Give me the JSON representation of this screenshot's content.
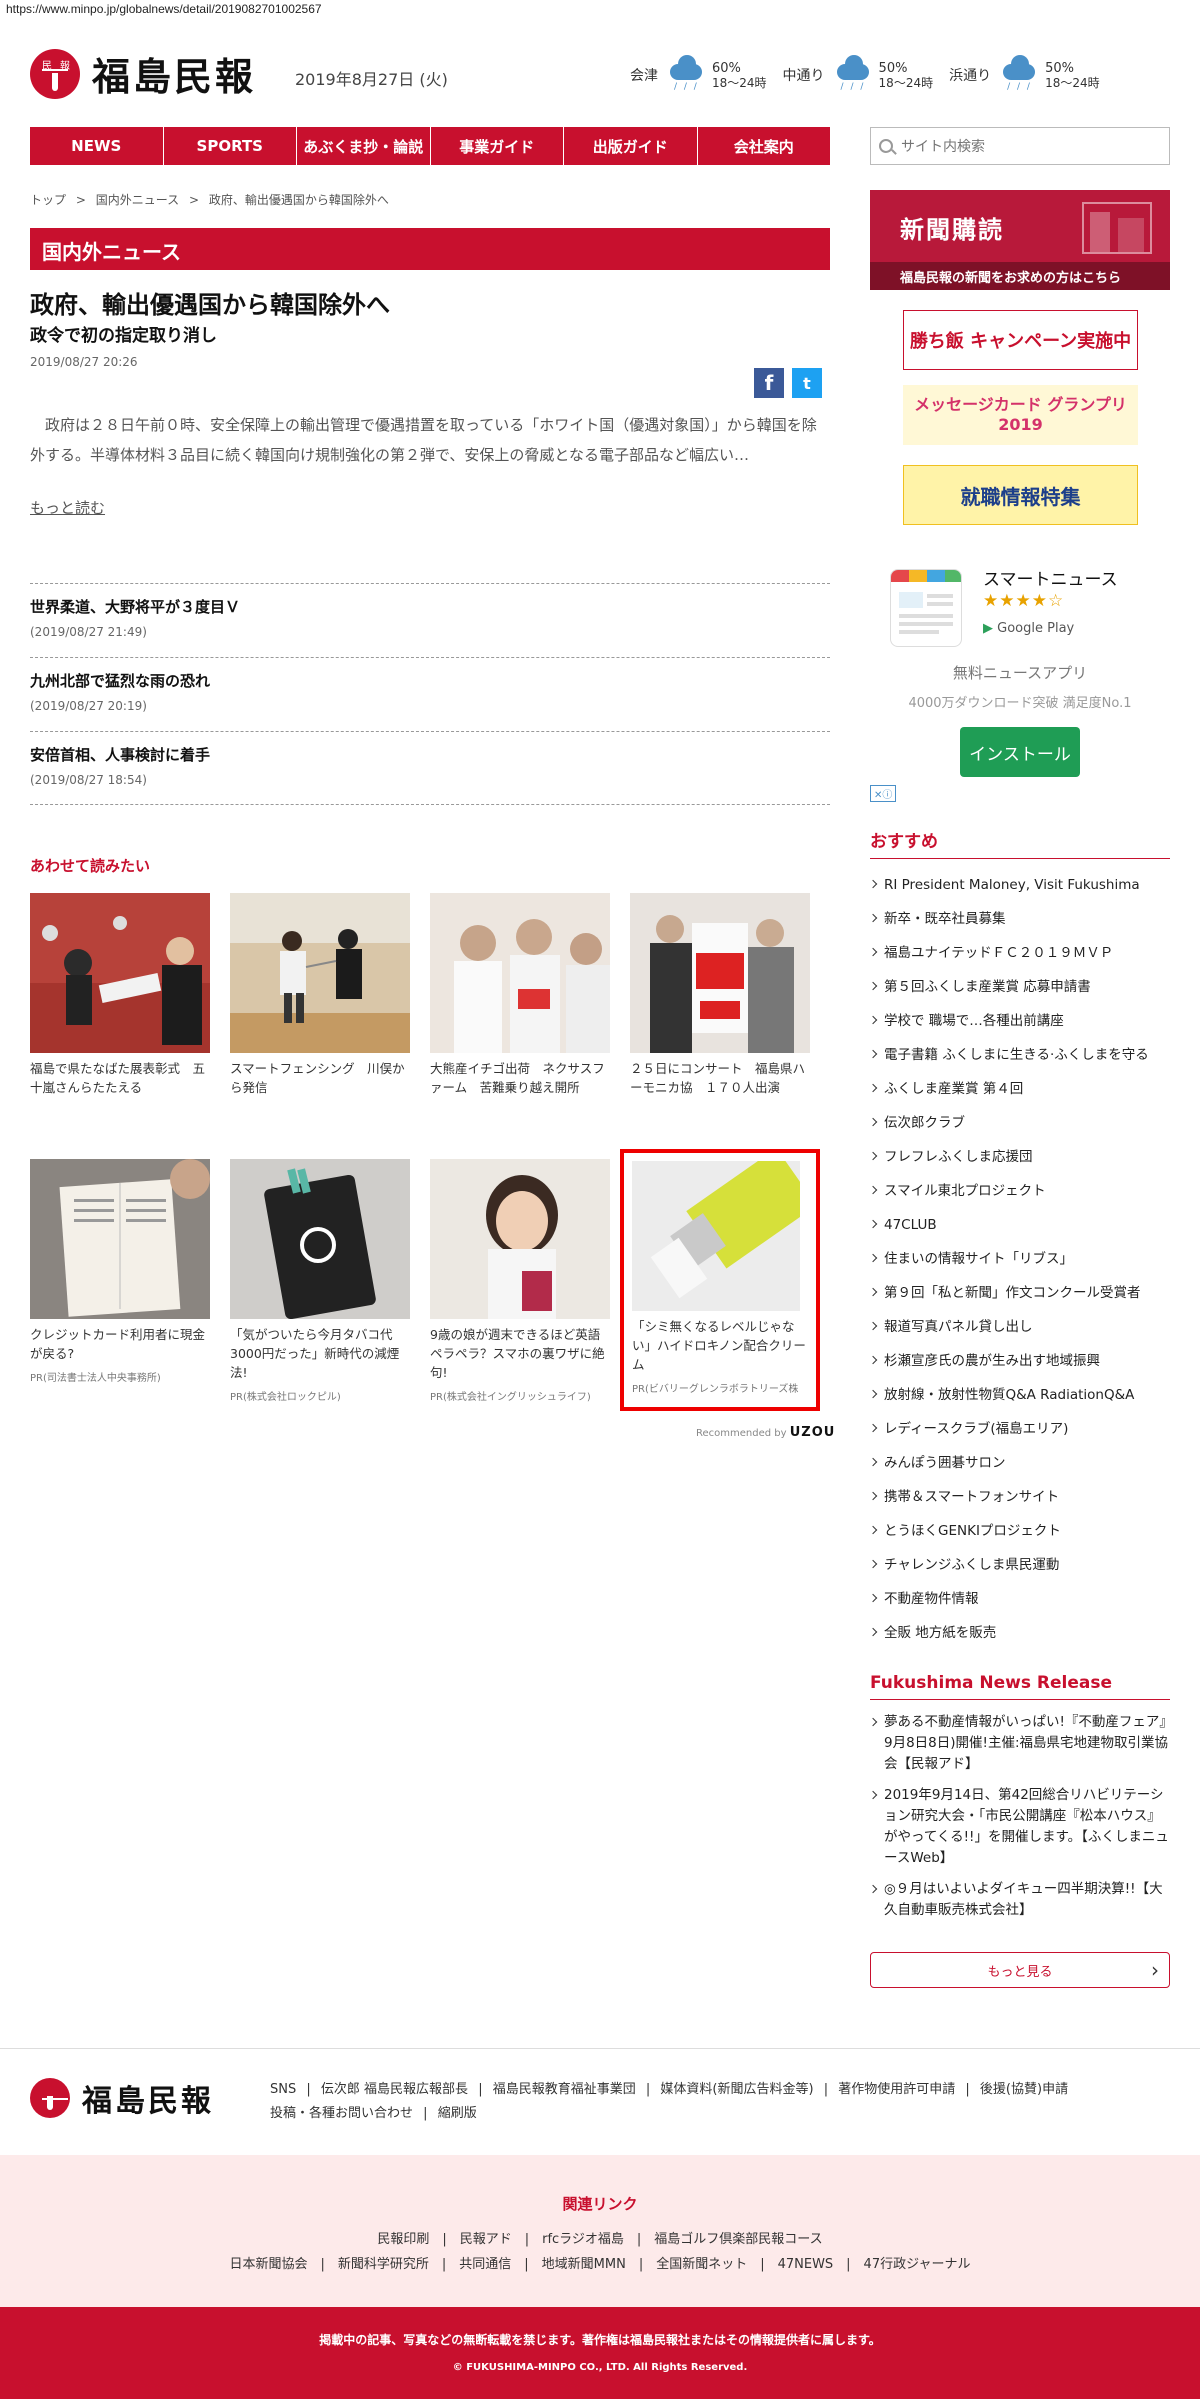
{
  "url": "https://www.minpo.jp/globalnews/detail/2019082701002567",
  "header": {
    "logo_mark": "民報",
    "logo_text": "福島民報",
    "date": "2019年8月27日 (火)",
    "weather": [
      {
        "city": "会津",
        "percent": "60%",
        "time": "18〜24時",
        "icon": "cloud-rain-icon"
      },
      {
        "city": "中通り",
        "percent": "50%",
        "time": "18〜24時",
        "icon": "cloud-rain-icon"
      },
      {
        "city": "浜通り",
        "percent": "50%",
        "time": "18〜24時",
        "icon": "umbrella-icon"
      }
    ]
  },
  "nav": [
    "NEWS",
    "SPORTS",
    "あぶくま抄・論説",
    "事業ガイド",
    "出版ガイド",
    "会社案内"
  ],
  "search": {
    "placeholder": "サイト内検索"
  },
  "breadcrumb": [
    "トップ",
    ">",
    "国内外ニュース",
    ">",
    "政府、輸出優遇国から韓国除外へ"
  ],
  "section": "国内外ニュース",
  "article": {
    "title": "政府、輸出優遇国から韓国除外へ",
    "subtitle": "政令で初の指定取り消し",
    "date": "2019/08/27 20:26",
    "body": "　政府は２８日午前０時、安全保障上の輸出管理で優遇措置を取っている「ホワイト国（優遇対象国）」から韓国を除外する。半導体材料３品目に続く韓国向け規制強化の第２弾で、安保上の脅威となる電子部品など幅広い…",
    "more": "もっと読む"
  },
  "share": {
    "facebook": "f",
    "twitter": "t"
  },
  "news_list": [
    {
      "title": "世界柔道、大野将平が３度目Ｖ",
      "date": "(2019/08/27 21:49)"
    },
    {
      "title": "九州北部で猛烈な雨の恐れ",
      "date": "(2019/08/27 20:19)"
    },
    {
      "title": "安倍首相、人事検討に着手",
      "date": "(2019/08/27 18:54)"
    }
  ],
  "recommend": {
    "heading": "あわせて読みたい",
    "row1": [
      {
        "caption": "福島で県たなばた展表彰式　五十嵐さんらたたえる"
      },
      {
        "caption": "スマートフェンシング　川俣から発信"
      },
      {
        "caption": "大熊産イチゴ出荷　ネクサスファーム　苦難乗り越え開所"
      },
      {
        "caption": "２５日にコンサート　福島県ハーモニカ協　１７０人出演"
      }
    ],
    "row2": [
      {
        "caption": "クレジットカード利用者に現金が戻る?",
        "pr": "PR(司法書士法人中央事務所)"
      },
      {
        "caption": "「気がついたら今月タバコ代3000円だった」新時代の減煙法!",
        "pr": "PR(株式会社ロックピル)"
      },
      {
        "caption": "9歳の娘が週末できるほど英語ペラペラ？スマホの裏ワザに絶句!",
        "pr": "PR(株式会社イングリッシュライフ)"
      },
      {
        "caption": "「シミ無くなるレベルじゃない」ハイドロキノン配合クリーム",
        "pr": "PR(ビバリーグレンラボラトリーズ株"
      }
    ],
    "recommended_by": "Recommended by",
    "brand": "UZOU"
  },
  "sidebar": {
    "subscribe_title": "新聞購読",
    "subscribe_bar": "福島民報の新聞をお求めの方はこちら",
    "banners": [
      "勝ち飯 キャンペーン実施中",
      "メッセージカード グランプリ2019",
      "就職情報特集"
    ],
    "app": {
      "name": "スマートニュース",
      "stars": "★★★★☆",
      "store": "Google Play",
      "desc": "無料ニュースアプリ",
      "downloads": "4000万ダウンロード突破 満足度No.1",
      "install": "インストール"
    },
    "adchoice": "✕ⓘ",
    "osusume_heading": "おすすめ",
    "osusume": [
      "RI President Maloney, Visit Fukushima",
      "新卒・既卒社員募集",
      "福島ユナイテッドＦＣ２０１９ＭＶＰ",
      "第５回ふくしま産業賞 応募申請書",
      "学校で 職場で…各種出前講座",
      "電子書籍 ふくしまに生きる·ふくしまを守る",
      "ふくしま産業賞 第４回",
      "伝次郎クラブ",
      "フレフレふくしま応援団",
      "スマイル東北プロジェクト",
      "47CLUB",
      "住まいの情報サイト「リブス」",
      "第９回「私と新聞」作文コンクール受賞者",
      "報道写真パネル貸し出し",
      "杉瀬宣彦氏の農が生み出す地域振興",
      "放射線・放射性物質Q&A RadiationQ&A",
      "レディースクラブ(福島エリア)",
      "みんぽう囲碁サロン",
      "携帯＆スマートフォンサイト",
      "とうほくGENKIプロジェクト",
      "チャレンジふくしま県民運動",
      "不動産物件情報",
      "全販 地方紙を販売"
    ],
    "fnr_heading": "Fukushima News Release",
    "fnr": [
      "夢ある不動産情報がいっぱい!『不動産フェア』9月8日8日)開催!主催:福島県宅地建物取引業協会【民報アド】",
      "2019年9月14日、第42回総合リハビリテーション研究大会・「市民公開講座『松本ハウス』がやってくる!!」を開催します。【ふくしまニュースWeb】",
      "◎９月はいよいよダイキュー四半期決算!!【大久自動車販売株式会社】"
    ],
    "more": "もっと見る"
  },
  "footer": {
    "logo_text": "福島民報",
    "links": [
      "SNS",
      "|",
      "伝次郎 福島民報広報部長",
      "|",
      "福島民報教育福祉事業団",
      "|",
      "媒体資料(新聞広告料金等)",
      "|",
      "著作物使用許可申請",
      "|",
      "後援(協賛)申請",
      "投稿・各種お問い合わせ",
      "|",
      "縮刷版"
    ],
    "related_title": "関連リンク",
    "related_row1": "民報印刷　|　民報アド　|　rfcラジオ福島　|　福島ゴルフ倶楽部民報コース",
    "related_row2": "日本新聞協会　|　新聞科学研究所　|　共同通信　|　地域新聞MMN　|　全国新聞ネット　|　47NEWS　|　47行政ジャーナル",
    "copy1": "掲載中の記事、写真などの無断転載を禁じます。著作権は福島民報社またはその情報提供者に属します。",
    "copy2": "© FUKUSHIMA-MINPO CO., LTD. All Rights Reserved."
  }
}
